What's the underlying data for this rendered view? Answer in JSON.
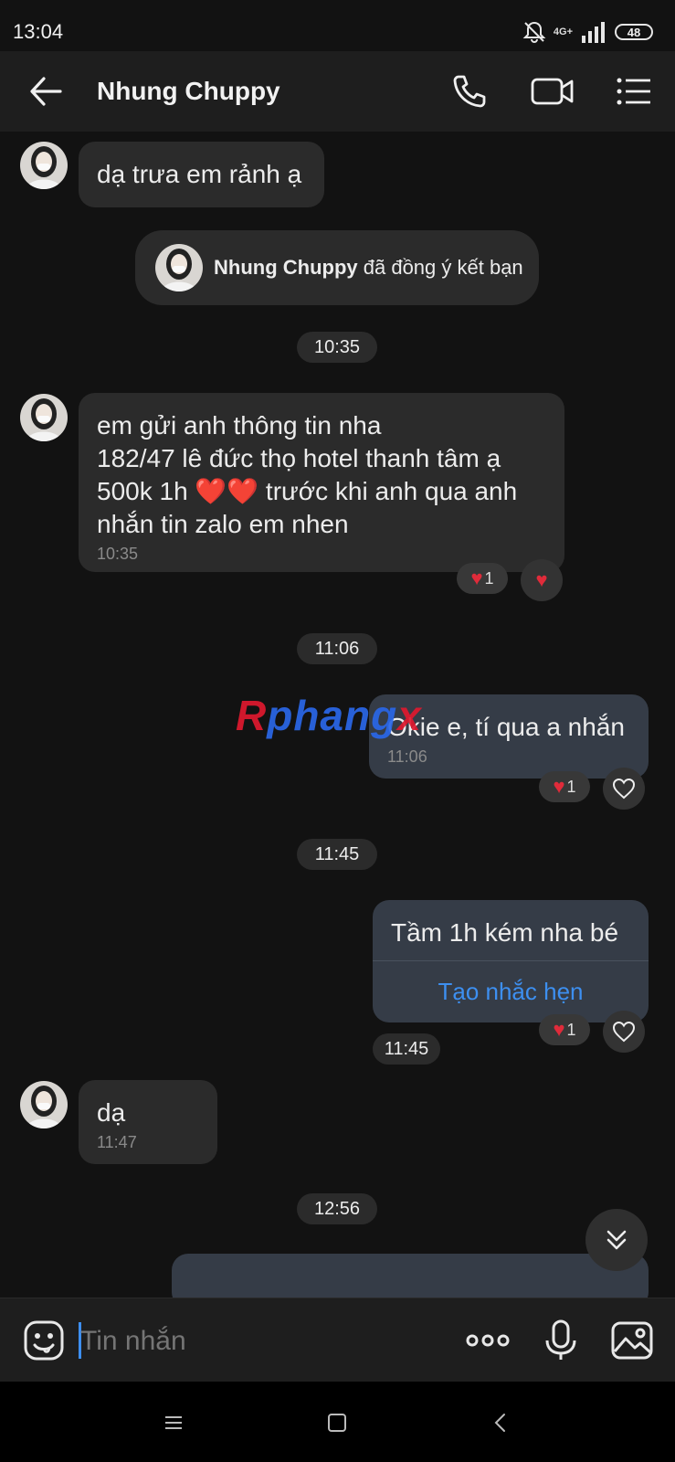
{
  "status": {
    "time": "13:04",
    "network": "4G+",
    "battery": "48"
  },
  "header": {
    "contact_name": "Nhung Chuppy"
  },
  "messages": {
    "m1_text": "dạ trưa em rảnh ạ",
    "system_name": "Nhung Chuppy",
    "system_action": " đã đồng ý kết bạn",
    "t1035": "10:35",
    "m2_line1": "em gửi anh thông tin nha",
    "m2_line2": "182/47 lê đức thọ hotel thanh tâm ạ",
    "m2_line3a": "500k 1h ",
    "m2_line3_hearts": "❤️❤️",
    "m2_line3b": " trước khi anh qua anh",
    "m2_line4": "nhắn tin zalo em nhen",
    "m2_time": "10:35",
    "m2_react_count": "1",
    "t1106": "11:06",
    "m3_text": "Okie e, tí qua a nhắn",
    "m3_time": "11:06",
    "m3_react_count": "1",
    "t1145": "11:45",
    "m4_text": "Tầm 1h kém nha bé",
    "m4_action": "Tạo nhắc hẹn",
    "m4_react_count": "1",
    "m4_time": "11:45",
    "m5_text": "dạ",
    "m5_time": "11:47",
    "t1256": "12:56"
  },
  "watermark": {
    "part1": "R",
    "part2": "phang",
    "part3": "x"
  },
  "input": {
    "placeholder": "Tin nhắn"
  },
  "colors": {
    "accent": "#3d8ff0",
    "heart": "#e02b3a",
    "bubble_in": "#2b2b2b",
    "bubble_out": "#353c47",
    "background": "#121212"
  },
  "icons": [
    "back-arrow-icon",
    "phone-icon",
    "video-call-icon",
    "menu-list-icon",
    "emoji-icon",
    "more-icon",
    "microphone-icon",
    "image-icon",
    "chevron-down-icon",
    "heart-icon"
  ]
}
